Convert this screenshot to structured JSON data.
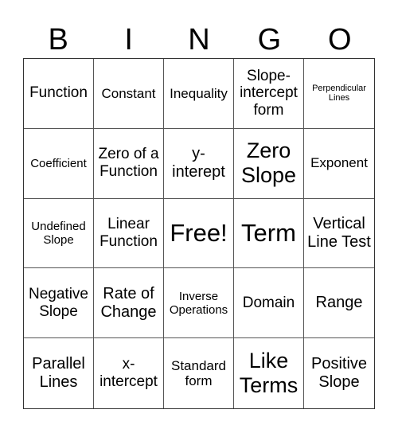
{
  "header": {
    "letters": [
      "B",
      "I",
      "N",
      "G",
      "O"
    ]
  },
  "cells": [
    "Function",
    "Constant",
    "Inequality",
    "Slope-intercept form",
    "Perpendicular Lines",
    "Coefficient",
    "Zero of a Function",
    "y-interept",
    "Zero Slope",
    "Exponent",
    "Undefined Slope",
    "Linear Function",
    "Free!",
    "Term",
    "Vertical Line Test",
    "Negative Slope",
    "Rate of Change",
    "Inverse Operations",
    "Domain",
    "Range",
    "Parallel Lines",
    "x-intercept",
    "Standard form",
    "Like Terms",
    "Positive Slope"
  ]
}
